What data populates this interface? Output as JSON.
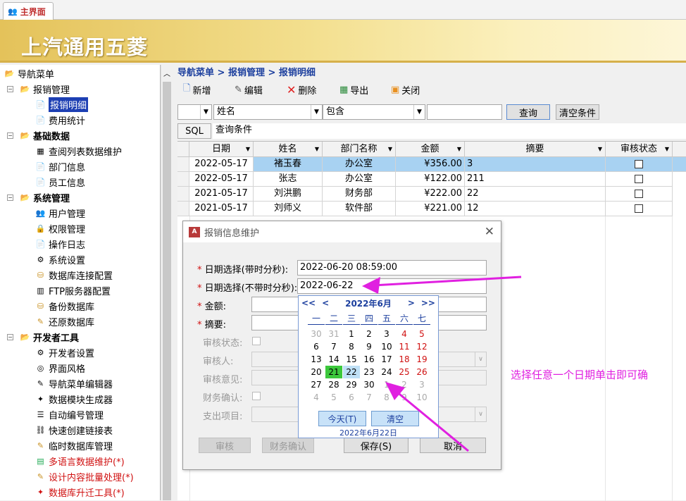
{
  "tab": {
    "label": "主界面"
  },
  "banner": {
    "brand": "上汽通用五菱"
  },
  "sidebar": {
    "items": [
      {
        "label": "导航菜单"
      },
      {
        "label": "报销管理"
      },
      {
        "label": "报销明细"
      },
      {
        "label": "费用统计"
      },
      {
        "label": "基础数据"
      },
      {
        "label": "查阅列表数据维护"
      },
      {
        "label": "部门信息"
      },
      {
        "label": "员工信息"
      },
      {
        "label": "系统管理"
      },
      {
        "label": "用户管理"
      },
      {
        "label": "权限管理"
      },
      {
        "label": "操作日志"
      },
      {
        "label": "系统设置"
      },
      {
        "label": "数据库连接配置"
      },
      {
        "label": "FTP服务器配置"
      },
      {
        "label": "备份数据库"
      },
      {
        "label": "还原数据库"
      },
      {
        "label": "开发者工具"
      },
      {
        "label": "开发者设置"
      },
      {
        "label": "界面风格"
      },
      {
        "label": "导航菜单编辑器"
      },
      {
        "label": "数据模块生成器"
      },
      {
        "label": "自动编号管理"
      },
      {
        "label": "快速创建链接表"
      },
      {
        "label": "临时数据库管理"
      },
      {
        "label": "多语言数据维护(*)"
      },
      {
        "label": "设计内容批量处理(*)"
      },
      {
        "label": "数据库升迁工具(*)"
      }
    ]
  },
  "breadcrumb": {
    "text": "导航菜单 > 报销管理 > 报销明细"
  },
  "toolbar": {
    "add": "新增",
    "edit": "编辑",
    "delete": "删除",
    "export": "导出",
    "close": "关闭"
  },
  "filter": {
    "field": "姓名",
    "op": "包含",
    "value": "",
    "query": "查询",
    "clear": "清空条件",
    "sql": "SQL",
    "sql_label": "查询条件"
  },
  "grid": {
    "headers": [
      "日期",
      "姓名",
      "部门名称",
      "金额",
      "摘要",
      "审核状态"
    ],
    "rows": [
      {
        "date": "2022-05-17",
        "name": "褚玉春",
        "dept": "办公室",
        "amount": "¥356.00",
        "memo": "3"
      },
      {
        "date": "2022-05-17",
        "name": "张志",
        "dept": "办公室",
        "amount": "¥122.00",
        "memo": "211"
      },
      {
        "date": "2021-05-17",
        "name": "刘洪鹏",
        "dept": "财务部",
        "amount": "¥222.00",
        "memo": "22"
      },
      {
        "date": "2021-05-17",
        "name": "刘师义",
        "dept": "软件部",
        "amount": "¥221.00",
        "memo": "12"
      }
    ]
  },
  "dialog": {
    "title": "报销信息维护",
    "datetime_label": "日期选择(带时分秒):",
    "datetime_value": "2022-06-20 08:59:00",
    "date_label": "日期选择(不带时分秒):",
    "date_value": "2022-06-22",
    "amount_label": "金额:",
    "memo_label": "摘要:",
    "audit_status_label": "审核状态:",
    "auditor_label": "审核人:",
    "audit_opinion_label": "审核意见:",
    "finance_label": "财务确认:",
    "expense_label": "支出项目:",
    "star": "*",
    "btn_audit": "审核",
    "btn_finance": "财务确认",
    "btn_save": "保存(S)",
    "btn_cancel": "取消"
  },
  "calendar": {
    "nav_first": "<<",
    "nav_prev": "<",
    "month": "2022年6月",
    "nav_next": ">",
    "nav_last": ">>",
    "weekdays": [
      "一",
      "二",
      "三",
      "四",
      "五",
      "六",
      "七"
    ],
    "weeks": [
      [
        "30",
        "31",
        "1",
        "2",
        "3",
        "4",
        "5"
      ],
      [
        "6",
        "7",
        "8",
        "9",
        "10",
        "11",
        "12"
      ],
      [
        "13",
        "14",
        "15",
        "16",
        "17",
        "18",
        "19"
      ],
      [
        "20",
        "21",
        "22",
        "23",
        "24",
        "25",
        "26"
      ],
      [
        "27",
        "28",
        "29",
        "30",
        "1",
        "2",
        "3"
      ],
      [
        "4",
        "5",
        "6",
        "7",
        "8",
        "9",
        "10"
      ]
    ],
    "today_btn": "今天(T)",
    "clear_btn": "清空",
    "footer": "2022年6月22日"
  },
  "annotation": "选择任意一个日期单击即可确",
  "colors": {
    "accent": "#e020e0",
    "nav": "#1c3f9e",
    "today": "#3cc83c",
    "weekend": "#d01010"
  }
}
